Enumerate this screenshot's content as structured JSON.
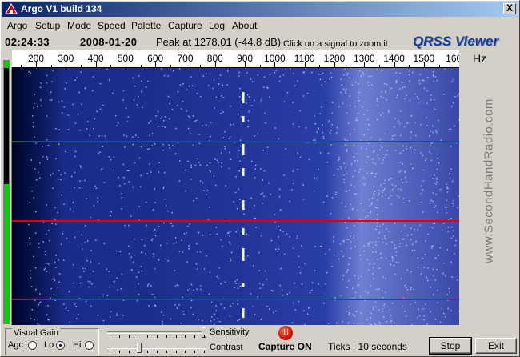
{
  "window": {
    "title": "Argo V1 build 134",
    "close_glyph": "X"
  },
  "menu": [
    {
      "label": "Argo"
    },
    {
      "label": "Setup"
    },
    {
      "label": "Mode"
    },
    {
      "label": "Speed"
    },
    {
      "label": "Palette"
    },
    {
      "label": "Capture"
    },
    {
      "label": "Log"
    },
    {
      "label": "About"
    }
  ],
  "info": {
    "time": "02:24:33",
    "date": "2008-01-20",
    "peak": "Peak at 1278.01 (-44.8 dB)",
    "hint": "Click on a signal to zoom it",
    "logo": "QRSS Viewer"
  },
  "scale": {
    "unit": "Hz",
    "ticks": [
      "200",
      "300",
      "400",
      "500",
      "600",
      "700",
      "800",
      "900",
      "1000",
      "1100",
      "1200",
      "1300",
      "1400",
      "1500",
      "160"
    ]
  },
  "watermark": "www.SecondHandRadio.com",
  "level": {
    "fraction": 0.53
  },
  "gain": {
    "legend": "Visual Gain",
    "options": [
      {
        "label": "Agc",
        "selected": false
      },
      {
        "label": "Lo",
        "selected": true
      },
      {
        "label": "Hi",
        "selected": false
      }
    ]
  },
  "controls": {
    "sensitivity_label": "Sensitivity",
    "sensitivity_value": 1.0,
    "contrast_label": "Contrast",
    "contrast_value": 0.31,
    "capture_status": "Capture ON",
    "ticks": "Ticks  : 10 seconds",
    "stop_label": "Stop",
    "exit_label": "Exit"
  },
  "colors": {
    "waterfall_bg": "#0b1a6e",
    "tick_line": "#e00000",
    "signal": "#ffffff",
    "level": "#00d000",
    "title_bar": "#0a246a"
  }
}
